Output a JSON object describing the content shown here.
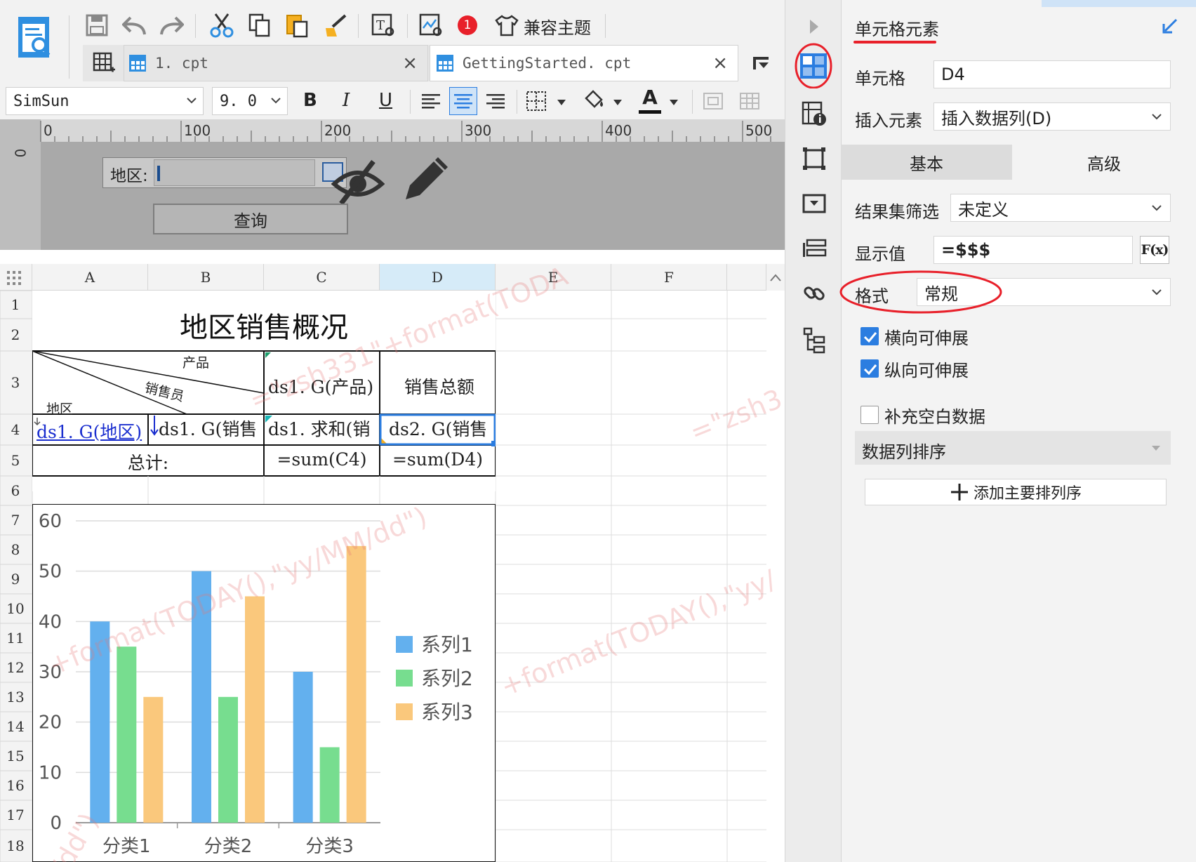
{
  "toolbar": {
    "compat_theme_label": "兼容主题",
    "notification_count": "1"
  },
  "tabs": [
    {
      "label": "1. cpt"
    },
    {
      "label": "GettingStarted. cpt"
    }
  ],
  "format_bar": {
    "font_family": "SimSun",
    "font_size": "9. 0",
    "bold": "B",
    "italic": "I",
    "underline": "U",
    "font_color_letter": "A"
  },
  "ruler": {
    "ticks": [
      "0",
      "100",
      "200",
      "300",
      "400",
      "500"
    ],
    "vertical_tick": "0"
  },
  "param_panel": {
    "region_label": "地区:",
    "query_button": "查询"
  },
  "grid": {
    "columns": [
      "A",
      "B",
      "C",
      "D",
      "E",
      "F"
    ],
    "rows": [
      "1",
      "2",
      "3",
      "4",
      "5",
      "6",
      "7",
      "8",
      "9",
      "10",
      "11",
      "12",
      "13",
      "14",
      "15",
      "16",
      "17",
      "18"
    ],
    "title": "地区销售概况",
    "header_product": "产品",
    "header_salesperson": "销售员",
    "header_region": "地区",
    "c3": "ds1. G(产品)",
    "d3": "销售总额",
    "a4": "ds1. G(地区)",
    "b4": "ds1. G(销售",
    "c4": "ds1. 求和(销",
    "d4": "ds2. G(销售",
    "a5": "总计:",
    "c5": "=sum(C4)",
    "d5": "=sum(D4)",
    "watermarks": [
      "=\"zsh331\"+format(TODA",
      "+format(TODAY(),\"yy/MM/dd\")",
      "=\"zsh3",
      "+format(TODAY(),\"yy/",
      "=\"zsh331\"+format(TODAY(),\"yy/",
      "/dd\")"
    ]
  },
  "chart_data": {
    "type": "bar",
    "categories": [
      "分类1",
      "分类2",
      "分类3"
    ],
    "series": [
      {
        "name": "系列1",
        "values": [
          40,
          50,
          30
        ],
        "color": "#63b0ee"
      },
      {
        "name": "系列2",
        "values": [
          35,
          25,
          15
        ],
        "color": "#77dd8f"
      },
      {
        "name": "系列3",
        "values": [
          25,
          45,
          55
        ],
        "color": "#fac87c"
      }
    ],
    "yticks": [
      "0",
      "10",
      "20",
      "30",
      "40",
      "50",
      "60"
    ],
    "ylim": [
      0,
      60
    ],
    "grid": true,
    "legend": "right"
  },
  "right_panel": {
    "title": "单元格元素",
    "cell_label": "单元格",
    "cell_value": "D4",
    "insert_label": "插入元素",
    "insert_value": "插入数据列(D)",
    "tab_basic": "基本",
    "tab_advanced": "高级",
    "filter_label": "结果集筛选",
    "filter_value": "未定义",
    "display_label": "显示值",
    "display_value": "=$$$",
    "fx_button": "F(x)",
    "format_label": "格式",
    "format_value": "常规",
    "horiz_expand": "横向可伸展",
    "vert_expand": "纵向可伸展",
    "fill_blank": "补充空白数据",
    "sort_label": "数据列排序",
    "add_sort": "添加主要排列序"
  },
  "colors": {
    "accent_blue": "#2b7de0",
    "annotation_red": "#e8202a",
    "selected_column": "#d6ebf8"
  }
}
